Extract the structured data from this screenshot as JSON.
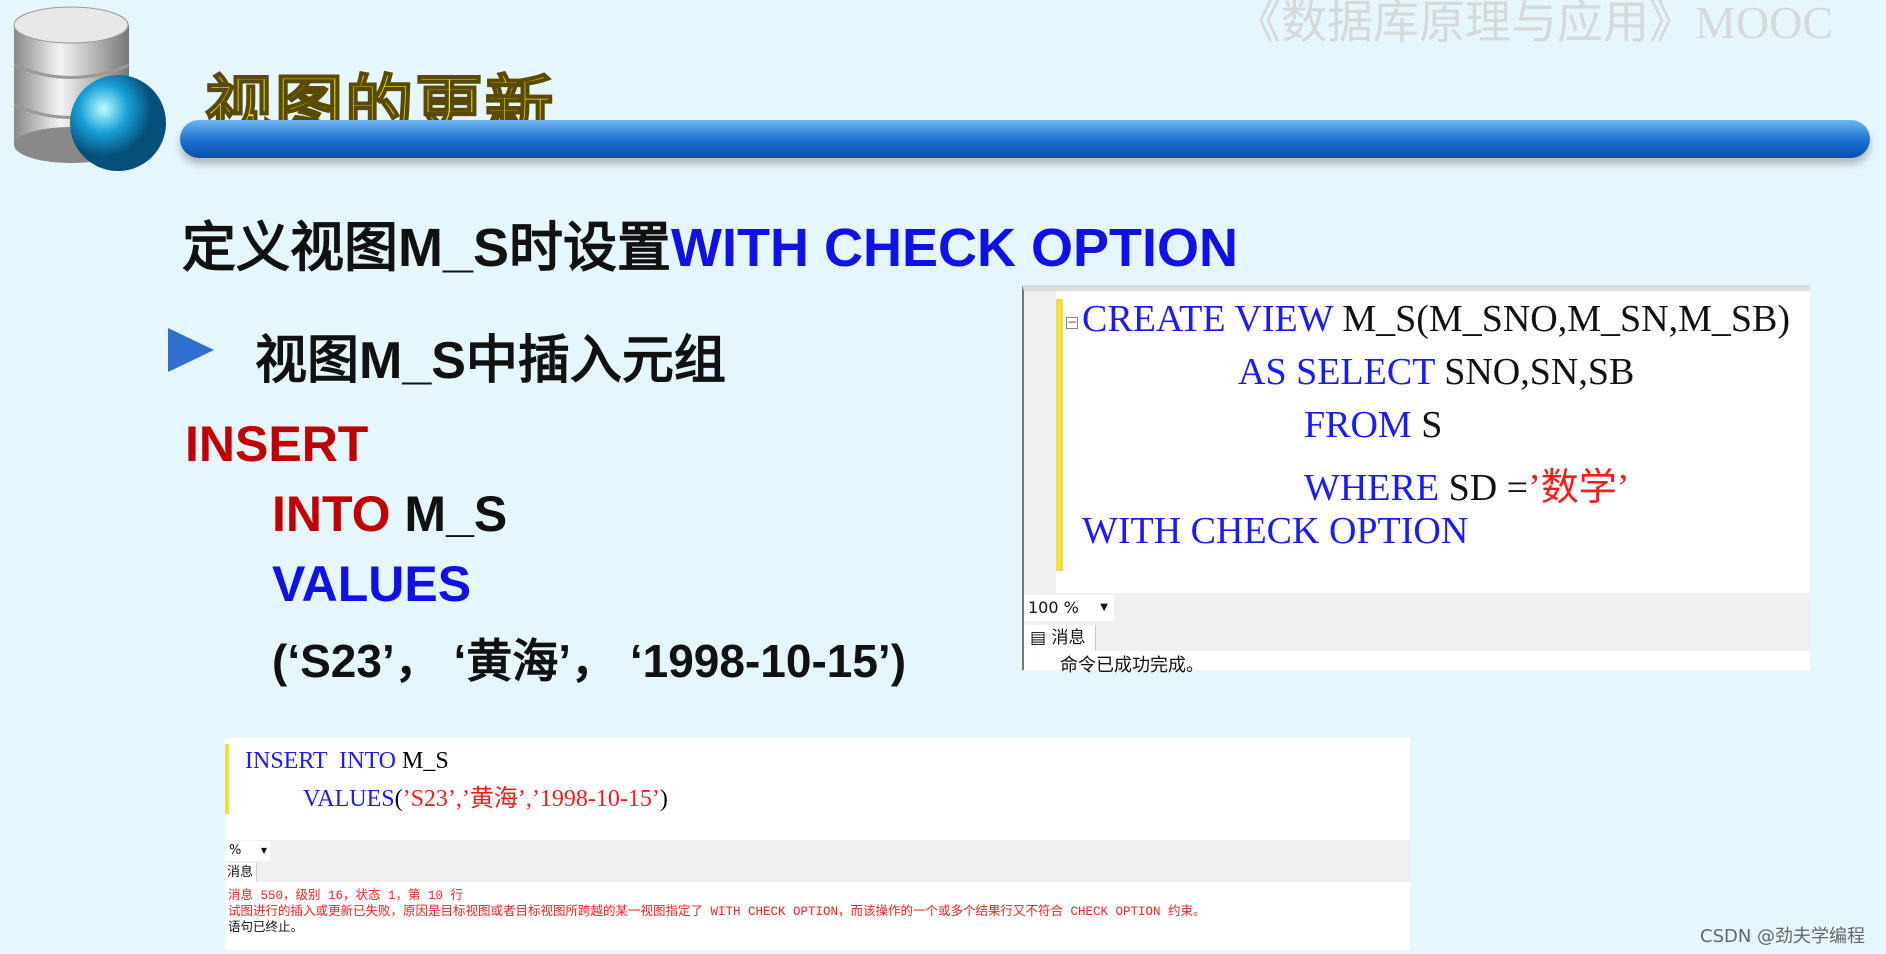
{
  "watermark": "《数据库原理与应用》MOOC",
  "title": "视图的更新",
  "heading": {
    "black": "定义视图M_S时设置",
    "blue": "WITH CHECK OPTION"
  },
  "subheading": "视图M_S中插入元组",
  "statement": {
    "insert": "INSERT",
    "into": "INTO",
    "table": " M_S",
    "values": "VALUES",
    "tuple": "(‘S23’， ‘黄海’， ‘1998-10-15’)"
  },
  "editor1": {
    "lines": [
      {
        "kw": "CREATE VIEW",
        "rest": " M_S(M_SNO,M_SN,M_SB)"
      },
      {
        "kw": "AS SELECT",
        "rest": " SNO,SN,SB"
      },
      {
        "kw": "FROM",
        "rest": " S"
      },
      {
        "kw": "WHERE",
        "rest": " SD =",
        "str": "’数学’"
      },
      {
        "kw": "WITH CHECK OPTION",
        "rest": ""
      }
    ],
    "zoom": "100 %",
    "tab": "消息",
    "message": "命令已成功完成。"
  },
  "editor2": {
    "line1": {
      "kw": "INSERT  INTO",
      "rest": " M_S"
    },
    "line2": {
      "kw": "VALUES",
      "rest": "(",
      "str": "’S23’,’黄海’,’1998-10-15’",
      "end": ")"
    },
    "zoom": "%",
    "tab": "消息",
    "error1": "消息 550，级别 16，状态 1，第 10 行",
    "error2": "试图进行的插入或更新已失败，原因是目标视图或者目标视图所跨越的某一视图指定了 WITH CHECK OPTION，而该操作的一个或多个结果行又不符合 CHECK OPTION 约束。",
    "error3": "语句已终止。"
  },
  "credit": "CSDN @劲夫学编程"
}
